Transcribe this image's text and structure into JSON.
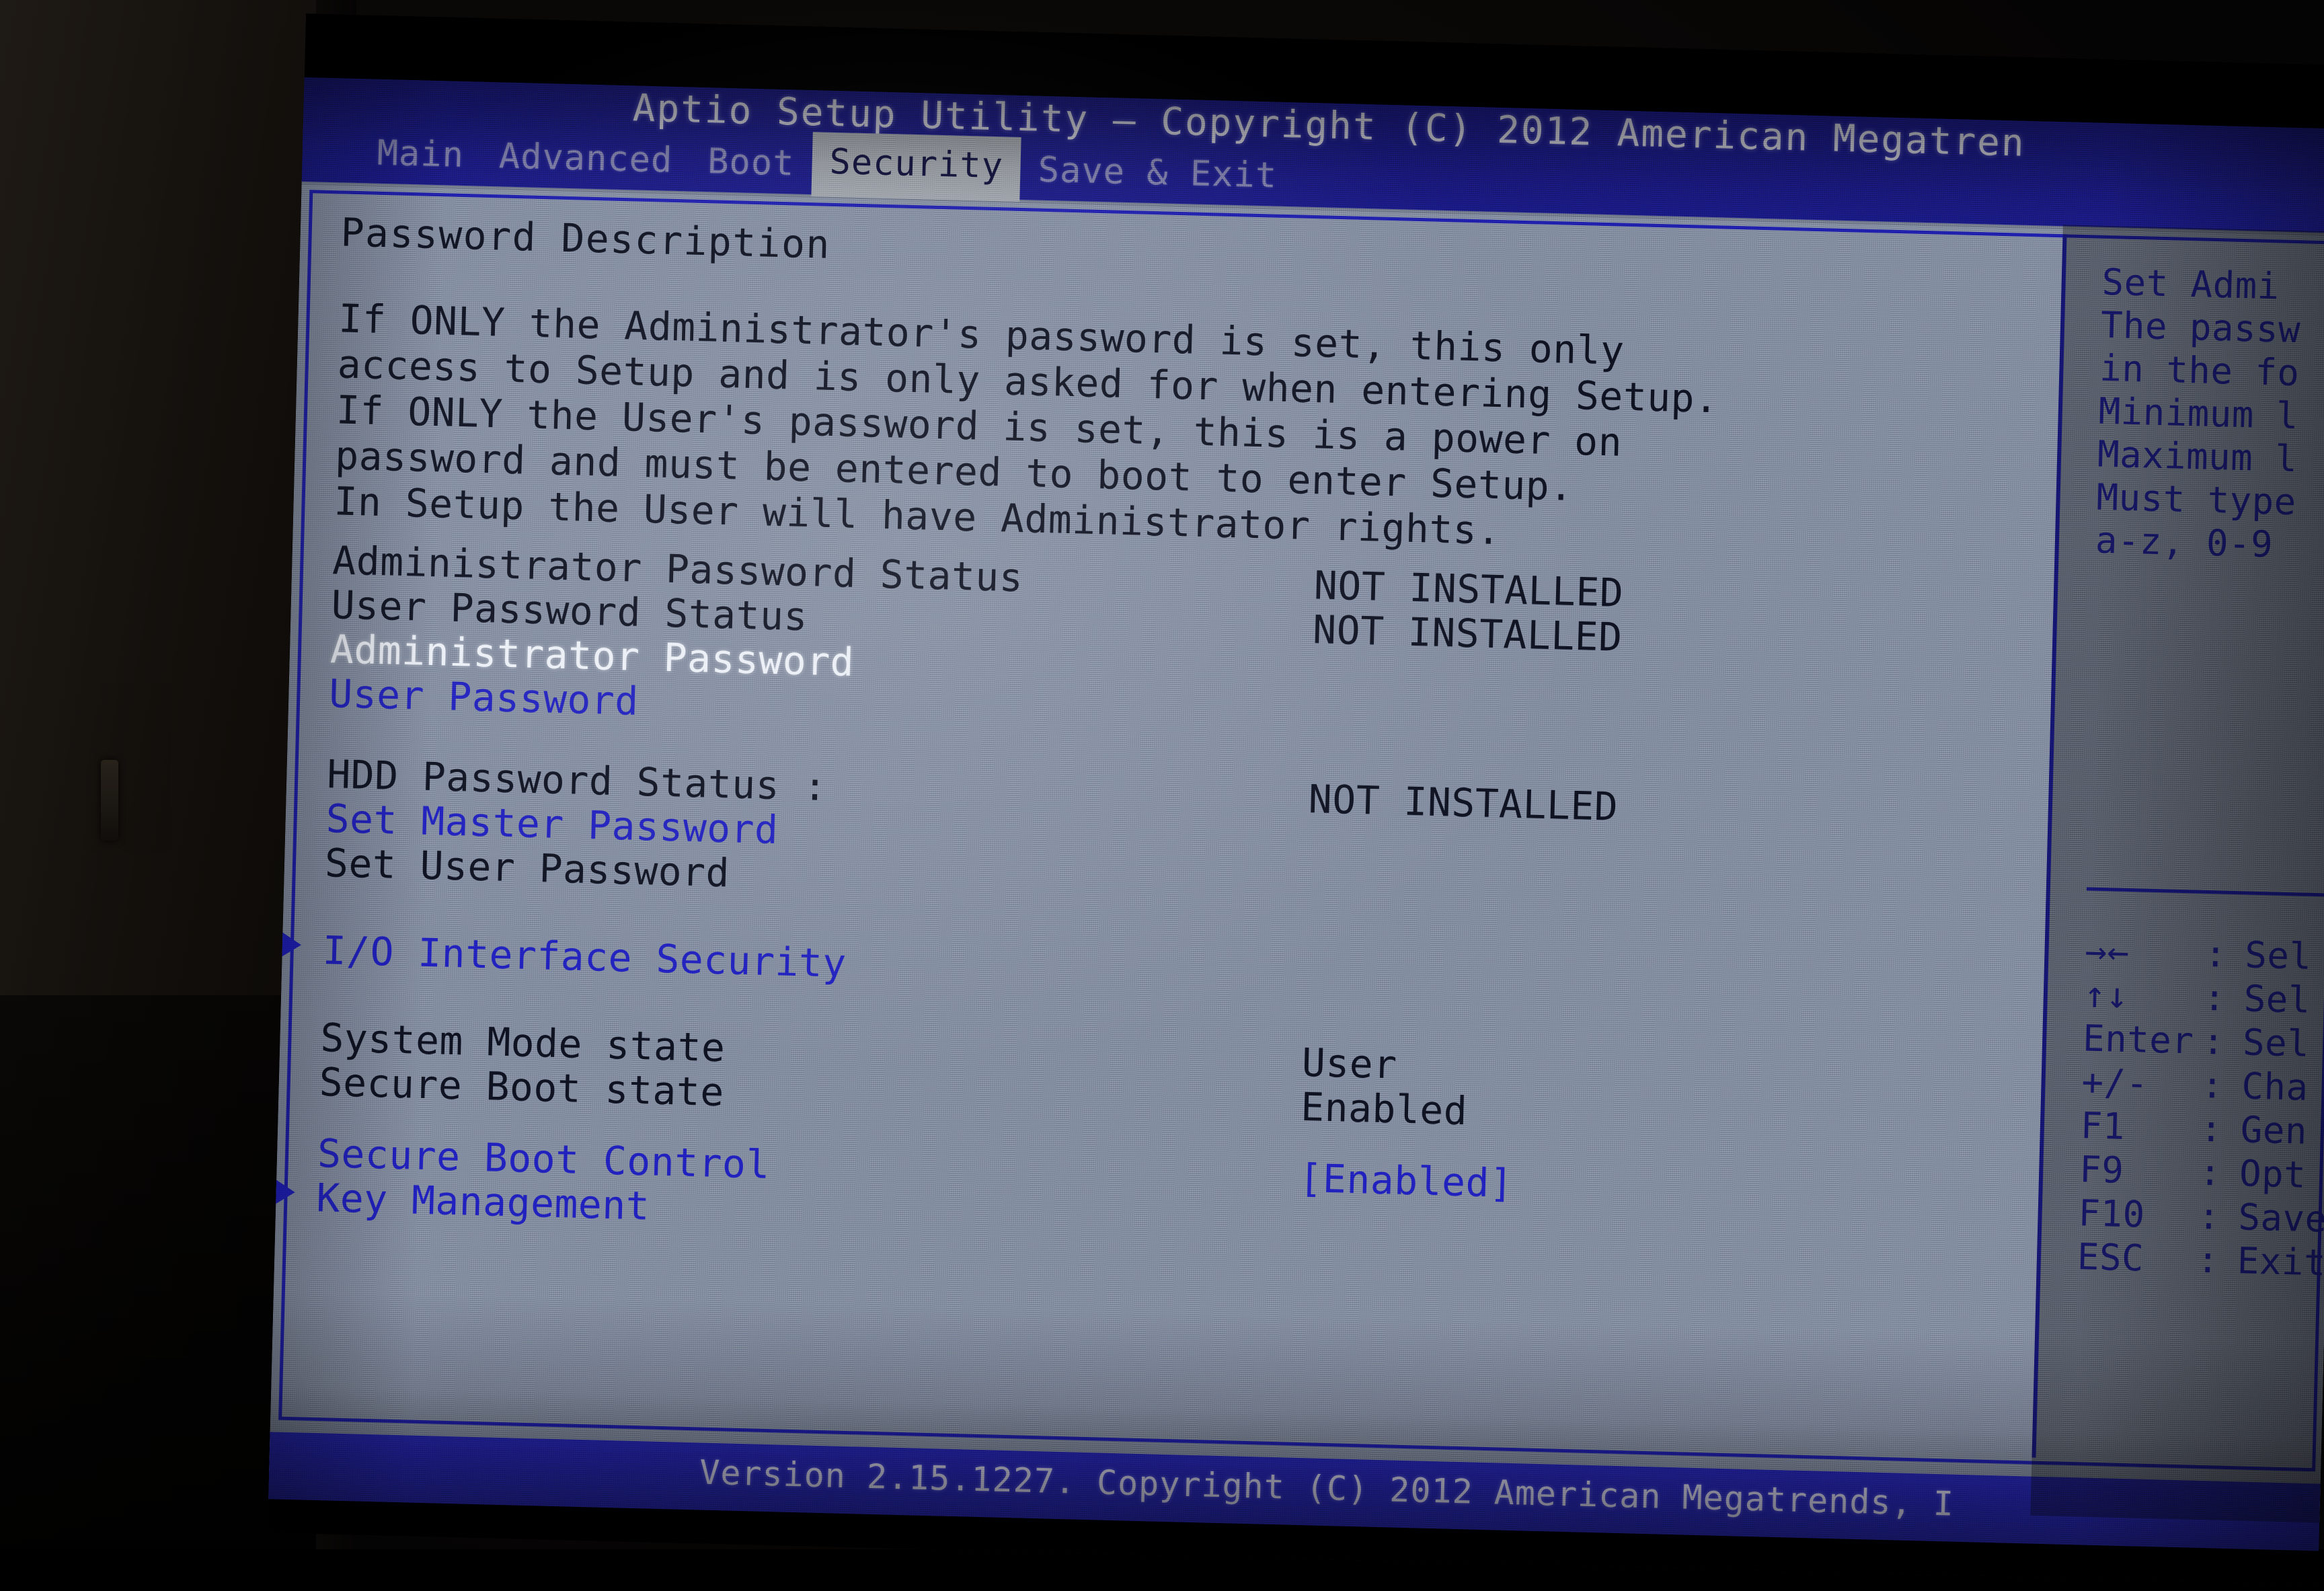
{
  "app": {
    "title": "Aptio Setup Utility – Copyright (C) 2012 American Megatren",
    "footer": "Version 2.15.1227. Copyright (C) 2012 American Megatrends, I"
  },
  "tabs": [
    {
      "label": "Main",
      "active": false
    },
    {
      "label": "Advanced",
      "active": false
    },
    {
      "label": "Boot",
      "active": false
    },
    {
      "label": "Security",
      "active": true
    },
    {
      "label": "Save & Exit",
      "active": false
    }
  ],
  "main": {
    "section_heading": "Password Description",
    "description_lines": [
      "If ONLY the Administrator's password is set, this only",
      "access to Setup and is only asked for when entering Setup.",
      "If ONLY the User's password is set, this is a power on",
      "password and must be entered to boot to enter Setup.",
      "In Setup the User will have Administrator rights."
    ],
    "rows": [
      {
        "label": "Administrator Password Status",
        "value": "NOT INSTALLED",
        "style": "dark",
        "value_style": "dark",
        "bullet": false
      },
      {
        "label": "User Password Status",
        "value": "NOT INSTALLED",
        "style": "dark",
        "value_style": "dark",
        "bullet": false
      },
      {
        "label": "Administrator Password",
        "value": "",
        "style": "white",
        "value_style": "dark",
        "bullet": false
      },
      {
        "label": "User Password",
        "value": "",
        "style": "blue",
        "value_style": "dark",
        "bullet": false
      },
      {
        "label": "HDD Password Status  :",
        "value": "NOT INSTALLED",
        "style": "dark",
        "value_style": "dark",
        "bullet": false
      },
      {
        "label": "Set Master Password",
        "value": "",
        "style": "blue",
        "value_style": "dark",
        "bullet": false
      },
      {
        "label": "Set User Password",
        "value": "",
        "style": "dark",
        "value_style": "dark",
        "bullet": false
      },
      {
        "label": "I/O Interface Security",
        "value": "",
        "style": "blue",
        "value_style": "dark",
        "bullet": true
      },
      {
        "label": "System Mode state",
        "value": "User",
        "style": "dark",
        "value_style": "dark",
        "bullet": false
      },
      {
        "label": "Secure Boot state",
        "value": "Enabled",
        "style": "dark",
        "value_style": "dark",
        "bullet": false
      },
      {
        "label": "Secure Boot Control",
        "value": "[Enabled]",
        "style": "blue",
        "value_style": "blue",
        "bullet": false
      },
      {
        "label": "Key Management",
        "value": "",
        "style": "blue",
        "value_style": "dark",
        "bullet": true
      }
    ]
  },
  "help": {
    "lines": [
      "Set Admi",
      "The passw",
      "in the fo",
      "Minimum l",
      "Maximum l",
      "Must type",
      "a-z, 0-9"
    ]
  },
  "key_legend": [
    {
      "key": "→←",
      "sep": ":",
      "desc": "Sel"
    },
    {
      "key": "↑↓",
      "sep": ":",
      "desc": "Sel"
    },
    {
      "key": "Enter",
      "sep": ":",
      "desc": "Sel"
    },
    {
      "key": "+/-",
      "sep": ":",
      "desc": "Cha"
    },
    {
      "key": "F1",
      "sep": ":",
      "desc": "Gen"
    },
    {
      "key": "F9",
      "sep": ":",
      "desc": "Opt"
    },
    {
      "key": "F10",
      "sep": ":",
      "desc": "Save"
    },
    {
      "key": "ESC",
      "sep": ":",
      "desc": "Exit"
    }
  ],
  "colors": {
    "header_blue": "#2020a0",
    "body_gray": "#8d96a8",
    "link_blue": "#2424c4",
    "text_dark": "#101425",
    "selected_white": "#edf1f7"
  }
}
